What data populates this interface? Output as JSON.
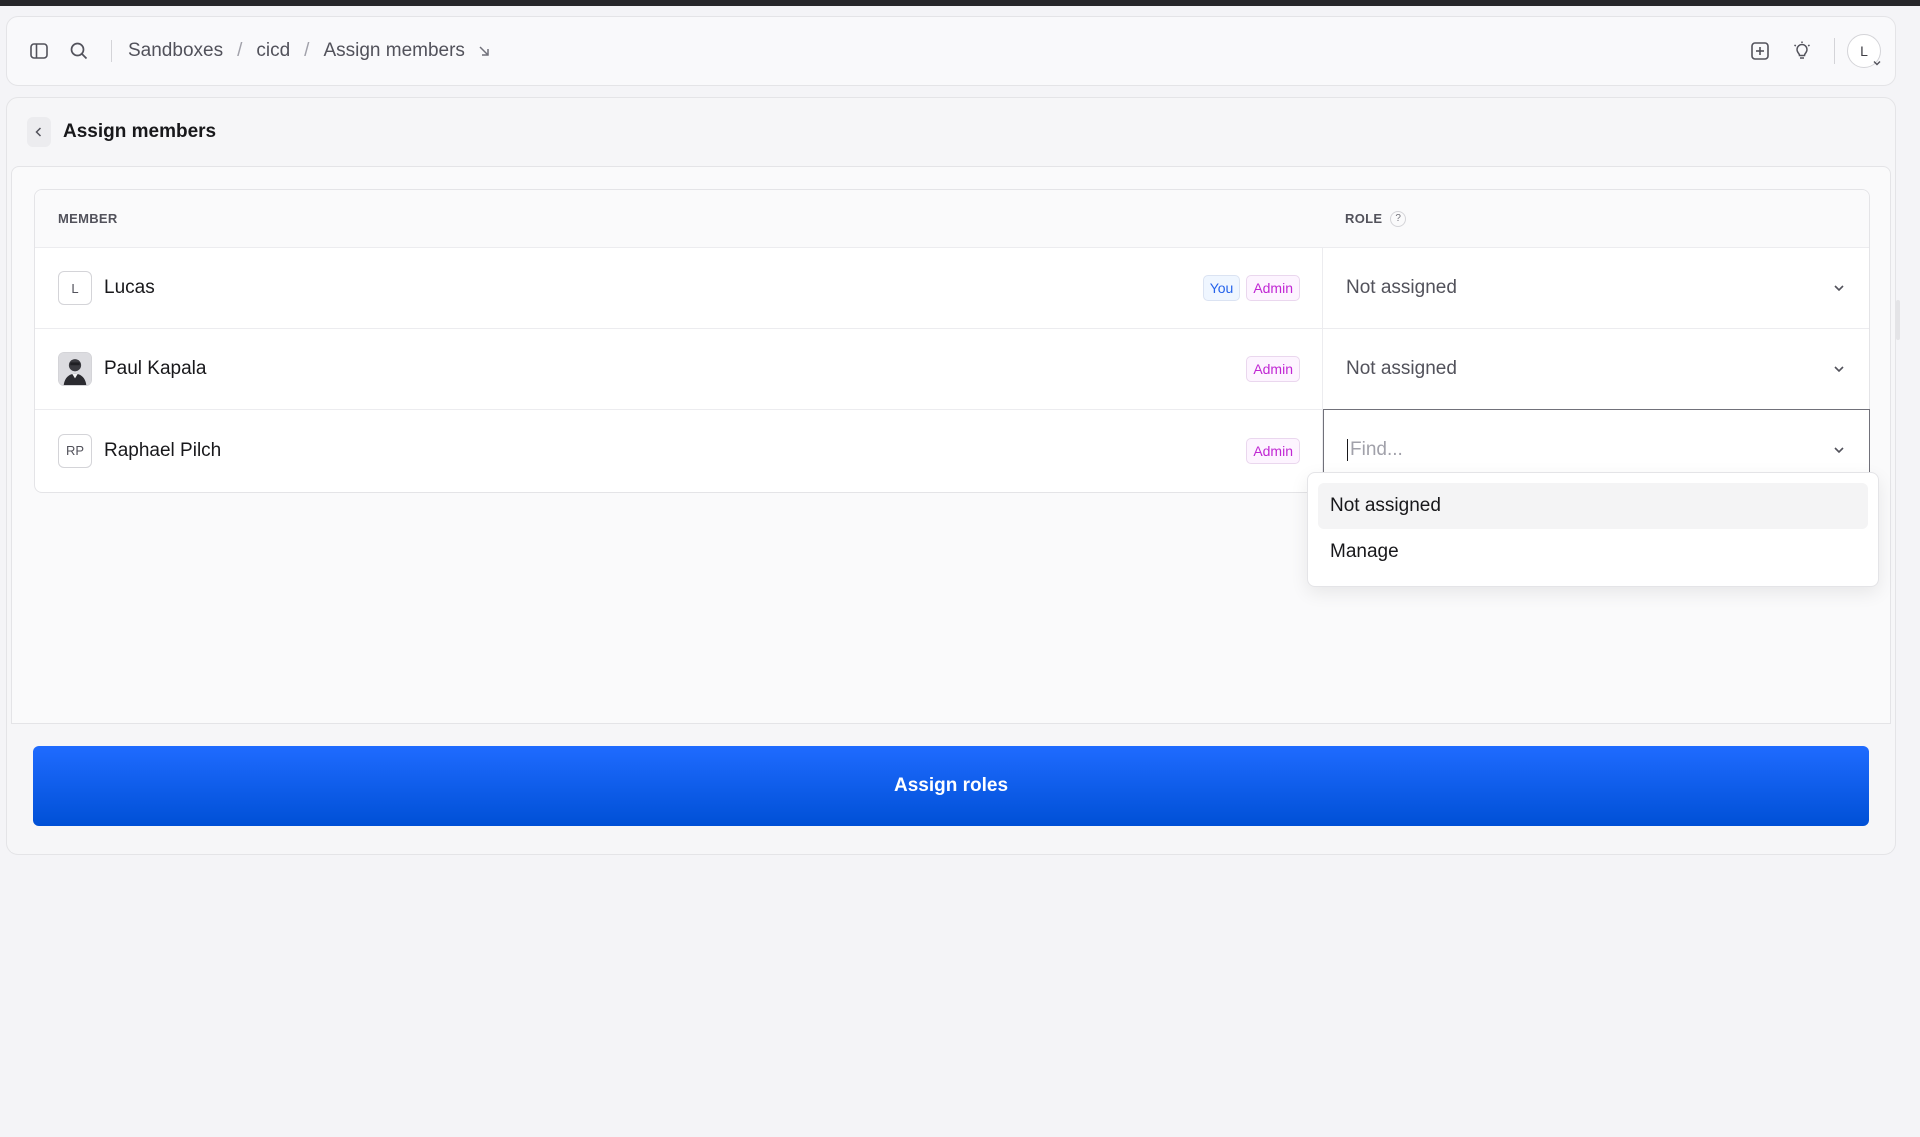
{
  "breadcrumb": {
    "items": [
      "Sandboxes",
      "cicd",
      "Assign members"
    ],
    "separator": "/"
  },
  "user_avatar": "L",
  "page": {
    "title": "Assign members"
  },
  "table": {
    "columns": {
      "member": "MEMBER",
      "role": "ROLE",
      "role_help": "?"
    },
    "rows": [
      {
        "initials": "L",
        "name": "Lucas",
        "badges": [
          "You",
          "Admin"
        ],
        "role": "Not assigned"
      },
      {
        "initials": "",
        "name": "Paul Kapala",
        "badges": [
          "Admin"
        ],
        "role": "Not assigned"
      },
      {
        "initials": "RP",
        "name": "Raphael Pilch",
        "badges": [
          "Admin"
        ],
        "role": ""
      }
    ]
  },
  "role_search": {
    "placeholder": "Find..."
  },
  "role_options": [
    "Not assigned",
    "Manage"
  ],
  "assign_button": "Assign roles",
  "colors": {
    "primary": "#1f6bff",
    "badge_you": "#2563eb",
    "badge_admin": "#c026d3"
  }
}
